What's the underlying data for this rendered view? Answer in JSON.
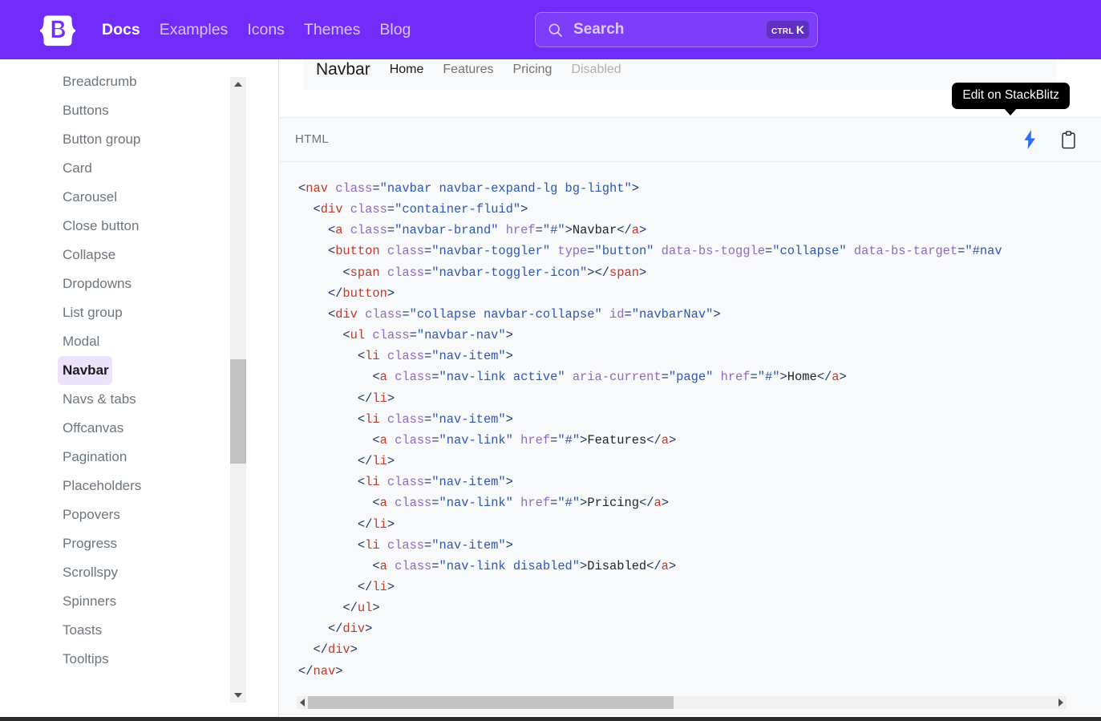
{
  "masthead": {
    "logo_icon": "bootstrap-logo-icon",
    "nav": [
      {
        "label": "Docs",
        "active": true
      },
      {
        "label": "Examples",
        "active": false
      },
      {
        "label": "Icons",
        "active": false
      },
      {
        "label": "Themes",
        "active": false
      },
      {
        "label": "Blog",
        "active": false
      }
    ],
    "search": {
      "icon": "search-icon",
      "placeholder": "Search",
      "shortcut_mod": "CTRL",
      "shortcut_key": "K"
    },
    "bg_color": "#712cf9"
  },
  "sidebar": {
    "items": [
      {
        "label": "",
        "state": "partial"
      },
      {
        "label": "Breadcrumb",
        "state": "normal"
      },
      {
        "label": "Buttons",
        "state": "normal"
      },
      {
        "label": "Button group",
        "state": "normal"
      },
      {
        "label": "Card",
        "state": "normal"
      },
      {
        "label": "Carousel",
        "state": "normal"
      },
      {
        "label": "Close button",
        "state": "normal"
      },
      {
        "label": "Collapse",
        "state": "normal"
      },
      {
        "label": "Dropdowns",
        "state": "normal"
      },
      {
        "label": "List group",
        "state": "normal"
      },
      {
        "label": "Modal",
        "state": "normal"
      },
      {
        "label": "Navbar",
        "state": "current"
      },
      {
        "label": "Navs & tabs",
        "state": "normal"
      },
      {
        "label": "Offcanvas",
        "state": "normal"
      },
      {
        "label": "Pagination",
        "state": "normal"
      },
      {
        "label": "Placeholders",
        "state": "normal"
      },
      {
        "label": "Popovers",
        "state": "normal"
      },
      {
        "label": "Progress",
        "state": "normal"
      },
      {
        "label": "Scrollspy",
        "state": "normal"
      },
      {
        "label": "Spinners",
        "state": "normal"
      },
      {
        "label": "Toasts",
        "state": "normal"
      },
      {
        "label": "Tooltips",
        "state": "normal"
      }
    ],
    "active_item": "Navbar",
    "active_bg": "#ece2fb",
    "scrollbar": {
      "up_arrow": "chevron-up-icon",
      "down_arrow": "chevron-down-icon"
    }
  },
  "preview": {
    "brand": "Navbar",
    "links": [
      {
        "label": "Home",
        "state": "active"
      },
      {
        "label": "Features",
        "state": "normal"
      },
      {
        "label": "Pricing",
        "state": "normal"
      },
      {
        "label": "Disabled",
        "state": "disabled"
      }
    ],
    "bg_color": "#f8f9fa"
  },
  "code_panel": {
    "language_label": "HTML",
    "stackblitz_icon": "lightning-bolt-icon",
    "copy_icon": "clipboard-icon",
    "tooltip": "Edit on StackBlitz",
    "tooltip_bg": "#000000",
    "stackblitz_color": "#2c6ef2",
    "lines": [
      [
        {
          "t": "punc",
          "v": "<"
        },
        {
          "t": "tag",
          "v": "nav"
        },
        {
          "t": "punc",
          "v": " "
        },
        {
          "t": "attr",
          "v": "class"
        },
        {
          "t": "punc",
          "v": "="
        },
        {
          "t": "val",
          "v": "\"navbar navbar-expand-lg bg-light\""
        },
        {
          "t": "punc",
          "v": ">"
        }
      ],
      [
        {
          "t": "punc",
          "v": "  <"
        },
        {
          "t": "tag",
          "v": "div"
        },
        {
          "t": "punc",
          "v": " "
        },
        {
          "t": "attr",
          "v": "class"
        },
        {
          "t": "punc",
          "v": "="
        },
        {
          "t": "val",
          "v": "\"container-fluid\""
        },
        {
          "t": "punc",
          "v": ">"
        }
      ],
      [
        {
          "t": "punc",
          "v": "    <"
        },
        {
          "t": "tag",
          "v": "a"
        },
        {
          "t": "punc",
          "v": " "
        },
        {
          "t": "attr",
          "v": "class"
        },
        {
          "t": "punc",
          "v": "="
        },
        {
          "t": "val",
          "v": "\"navbar-brand\""
        },
        {
          "t": "punc",
          "v": " "
        },
        {
          "t": "attr",
          "v": "href"
        },
        {
          "t": "punc",
          "v": "="
        },
        {
          "t": "val",
          "v": "\"#\""
        },
        {
          "t": "punc",
          "v": ">"
        },
        {
          "t": "text",
          "v": "Navbar"
        },
        {
          "t": "punc",
          "v": "</"
        },
        {
          "t": "tag",
          "v": "a"
        },
        {
          "t": "punc",
          "v": ">"
        }
      ],
      [
        {
          "t": "punc",
          "v": "    <"
        },
        {
          "t": "tag",
          "v": "button"
        },
        {
          "t": "punc",
          "v": " "
        },
        {
          "t": "attr",
          "v": "class"
        },
        {
          "t": "punc",
          "v": "="
        },
        {
          "t": "val",
          "v": "\"navbar-toggler\""
        },
        {
          "t": "punc",
          "v": " "
        },
        {
          "t": "attr",
          "v": "type"
        },
        {
          "t": "punc",
          "v": "="
        },
        {
          "t": "val",
          "v": "\"button\""
        },
        {
          "t": "punc",
          "v": " "
        },
        {
          "t": "attr",
          "v": "data-bs-toggle"
        },
        {
          "t": "punc",
          "v": "="
        },
        {
          "t": "val",
          "v": "\"collapse\""
        },
        {
          "t": "punc",
          "v": " "
        },
        {
          "t": "attr",
          "v": "data-bs-target"
        },
        {
          "t": "punc",
          "v": "="
        },
        {
          "t": "val",
          "v": "\"#nav"
        }
      ],
      [
        {
          "t": "punc",
          "v": "      <"
        },
        {
          "t": "tag",
          "v": "span"
        },
        {
          "t": "punc",
          "v": " "
        },
        {
          "t": "attr",
          "v": "class"
        },
        {
          "t": "punc",
          "v": "="
        },
        {
          "t": "val",
          "v": "\"navbar-toggler-icon\""
        },
        {
          "t": "punc",
          "v": "></"
        },
        {
          "t": "tag",
          "v": "span"
        },
        {
          "t": "punc",
          "v": ">"
        }
      ],
      [
        {
          "t": "punc",
          "v": "    </"
        },
        {
          "t": "tag",
          "v": "button"
        },
        {
          "t": "punc",
          "v": ">"
        }
      ],
      [
        {
          "t": "punc",
          "v": "    <"
        },
        {
          "t": "tag",
          "v": "div"
        },
        {
          "t": "punc",
          "v": " "
        },
        {
          "t": "attr",
          "v": "class"
        },
        {
          "t": "punc",
          "v": "="
        },
        {
          "t": "val",
          "v": "\"collapse navbar-collapse\""
        },
        {
          "t": "punc",
          "v": " "
        },
        {
          "t": "attr",
          "v": "id"
        },
        {
          "t": "punc",
          "v": "="
        },
        {
          "t": "val",
          "v": "\"navbarNav\""
        },
        {
          "t": "punc",
          "v": ">"
        }
      ],
      [
        {
          "t": "punc",
          "v": "      <"
        },
        {
          "t": "tag",
          "v": "ul"
        },
        {
          "t": "punc",
          "v": " "
        },
        {
          "t": "attr",
          "v": "class"
        },
        {
          "t": "punc",
          "v": "="
        },
        {
          "t": "val",
          "v": "\"navbar-nav\""
        },
        {
          "t": "punc",
          "v": ">"
        }
      ],
      [
        {
          "t": "punc",
          "v": "        <"
        },
        {
          "t": "tag",
          "v": "li"
        },
        {
          "t": "punc",
          "v": " "
        },
        {
          "t": "attr",
          "v": "class"
        },
        {
          "t": "punc",
          "v": "="
        },
        {
          "t": "val",
          "v": "\"nav-item\""
        },
        {
          "t": "punc",
          "v": ">"
        }
      ],
      [
        {
          "t": "punc",
          "v": "          <"
        },
        {
          "t": "tag",
          "v": "a"
        },
        {
          "t": "punc",
          "v": " "
        },
        {
          "t": "attr",
          "v": "class"
        },
        {
          "t": "punc",
          "v": "="
        },
        {
          "t": "val",
          "v": "\"nav-link active\""
        },
        {
          "t": "punc",
          "v": " "
        },
        {
          "t": "attr",
          "v": "aria-current"
        },
        {
          "t": "punc",
          "v": "="
        },
        {
          "t": "val",
          "v": "\"page\""
        },
        {
          "t": "punc",
          "v": " "
        },
        {
          "t": "attr",
          "v": "href"
        },
        {
          "t": "punc",
          "v": "="
        },
        {
          "t": "val",
          "v": "\"#\""
        },
        {
          "t": "punc",
          "v": ">"
        },
        {
          "t": "text",
          "v": "Home"
        },
        {
          "t": "punc",
          "v": "</"
        },
        {
          "t": "tag",
          "v": "a"
        },
        {
          "t": "punc",
          "v": ">"
        }
      ],
      [
        {
          "t": "punc",
          "v": "        </"
        },
        {
          "t": "tag",
          "v": "li"
        },
        {
          "t": "punc",
          "v": ">"
        }
      ],
      [
        {
          "t": "punc",
          "v": "        <"
        },
        {
          "t": "tag",
          "v": "li"
        },
        {
          "t": "punc",
          "v": " "
        },
        {
          "t": "attr",
          "v": "class"
        },
        {
          "t": "punc",
          "v": "="
        },
        {
          "t": "val",
          "v": "\"nav-item\""
        },
        {
          "t": "punc",
          "v": ">"
        }
      ],
      [
        {
          "t": "punc",
          "v": "          <"
        },
        {
          "t": "tag",
          "v": "a"
        },
        {
          "t": "punc",
          "v": " "
        },
        {
          "t": "attr",
          "v": "class"
        },
        {
          "t": "punc",
          "v": "="
        },
        {
          "t": "val",
          "v": "\"nav-link\""
        },
        {
          "t": "punc",
          "v": " "
        },
        {
          "t": "attr",
          "v": "href"
        },
        {
          "t": "punc",
          "v": "="
        },
        {
          "t": "val",
          "v": "\"#\""
        },
        {
          "t": "punc",
          "v": ">"
        },
        {
          "t": "text",
          "v": "Features"
        },
        {
          "t": "punc",
          "v": "</"
        },
        {
          "t": "tag",
          "v": "a"
        },
        {
          "t": "punc",
          "v": ">"
        }
      ],
      [
        {
          "t": "punc",
          "v": "        </"
        },
        {
          "t": "tag",
          "v": "li"
        },
        {
          "t": "punc",
          "v": ">"
        }
      ],
      [
        {
          "t": "punc",
          "v": "        <"
        },
        {
          "t": "tag",
          "v": "li"
        },
        {
          "t": "punc",
          "v": " "
        },
        {
          "t": "attr",
          "v": "class"
        },
        {
          "t": "punc",
          "v": "="
        },
        {
          "t": "val",
          "v": "\"nav-item\""
        },
        {
          "t": "punc",
          "v": ">"
        }
      ],
      [
        {
          "t": "punc",
          "v": "          <"
        },
        {
          "t": "tag",
          "v": "a"
        },
        {
          "t": "punc",
          "v": " "
        },
        {
          "t": "attr",
          "v": "class"
        },
        {
          "t": "punc",
          "v": "="
        },
        {
          "t": "val",
          "v": "\"nav-link\""
        },
        {
          "t": "punc",
          "v": " "
        },
        {
          "t": "attr",
          "v": "href"
        },
        {
          "t": "punc",
          "v": "="
        },
        {
          "t": "val",
          "v": "\"#\""
        },
        {
          "t": "punc",
          "v": ">"
        },
        {
          "t": "text",
          "v": "Pricing"
        },
        {
          "t": "punc",
          "v": "</"
        },
        {
          "t": "tag",
          "v": "a"
        },
        {
          "t": "punc",
          "v": ">"
        }
      ],
      [
        {
          "t": "punc",
          "v": "        </"
        },
        {
          "t": "tag",
          "v": "li"
        },
        {
          "t": "punc",
          "v": ">"
        }
      ],
      [
        {
          "t": "punc",
          "v": "        <"
        },
        {
          "t": "tag",
          "v": "li"
        },
        {
          "t": "punc",
          "v": " "
        },
        {
          "t": "attr",
          "v": "class"
        },
        {
          "t": "punc",
          "v": "="
        },
        {
          "t": "val",
          "v": "\"nav-item\""
        },
        {
          "t": "punc",
          "v": ">"
        }
      ],
      [
        {
          "t": "punc",
          "v": "          <"
        },
        {
          "t": "tag",
          "v": "a"
        },
        {
          "t": "punc",
          "v": " "
        },
        {
          "t": "attr",
          "v": "class"
        },
        {
          "t": "punc",
          "v": "="
        },
        {
          "t": "val",
          "v": "\"nav-link disabled\""
        },
        {
          "t": "punc",
          "v": ">"
        },
        {
          "t": "text",
          "v": "Disabled"
        },
        {
          "t": "punc",
          "v": "</"
        },
        {
          "t": "tag",
          "v": "a"
        },
        {
          "t": "punc",
          "v": ">"
        }
      ],
      [
        {
          "t": "punc",
          "v": "        </"
        },
        {
          "t": "tag",
          "v": "li"
        },
        {
          "t": "punc",
          "v": ">"
        }
      ],
      [
        {
          "t": "punc",
          "v": "      </"
        },
        {
          "t": "tag",
          "v": "ul"
        },
        {
          "t": "punc",
          "v": ">"
        }
      ],
      [
        {
          "t": "punc",
          "v": "    </"
        },
        {
          "t": "tag",
          "v": "div"
        },
        {
          "t": "punc",
          "v": ">"
        }
      ],
      [
        {
          "t": "punc",
          "v": "  </"
        },
        {
          "t": "tag",
          "v": "div"
        },
        {
          "t": "punc",
          "v": ">"
        }
      ],
      [
        {
          "t": "punc",
          "v": "</"
        },
        {
          "t": "tag",
          "v": "nav"
        },
        {
          "t": "punc",
          "v": ">"
        }
      ]
    ],
    "hscroll": {
      "left_arrow": "arrow-left-icon",
      "right_arrow": "arrow-right-icon"
    }
  }
}
